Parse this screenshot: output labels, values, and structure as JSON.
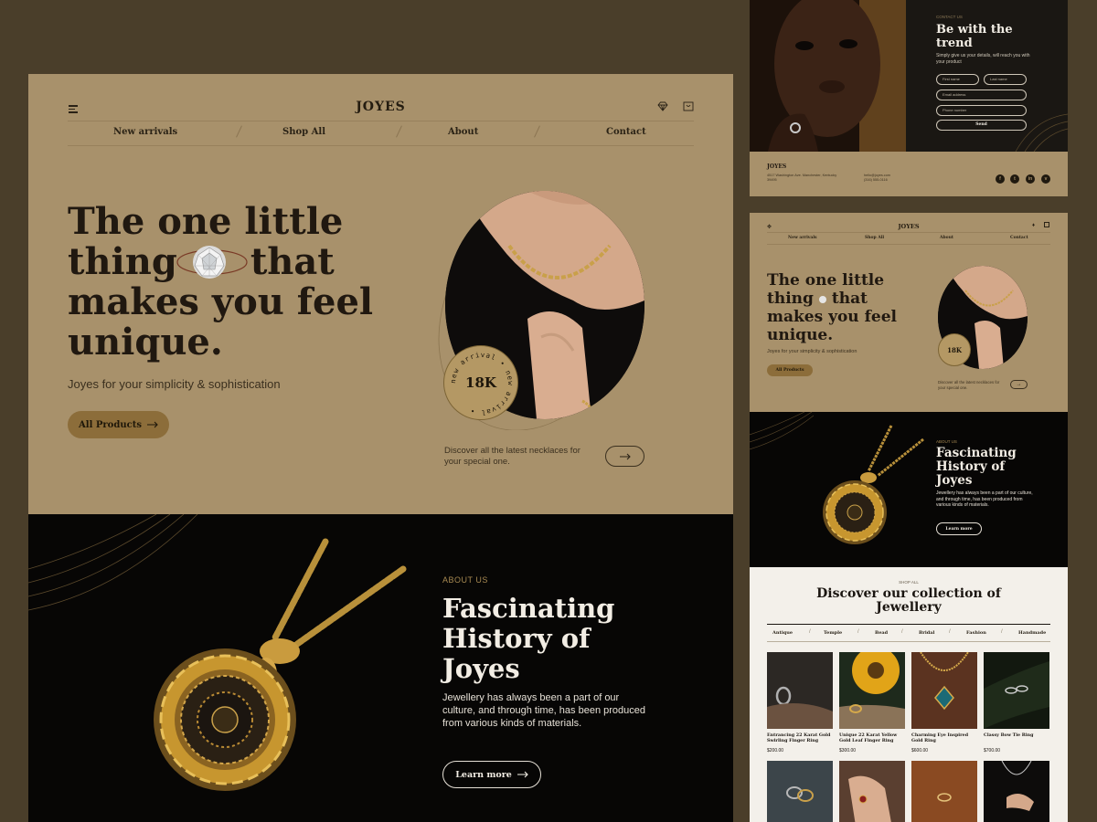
{
  "main": {
    "brand": "JOYES",
    "nav": [
      "New arrivals",
      "Shop All",
      "About",
      "Contact"
    ],
    "hero": {
      "title_line1": "The one little",
      "title_line2a": "thing",
      "title_line2b": "that",
      "title_line3": "makes you feel",
      "title_line4": "unique.",
      "subtitle": "Joyes for your simplicity & sophistication",
      "cta": "All Products",
      "badge_number": "18K",
      "badge_ring_text": "new arrival • new arrival •",
      "discover_text": "Discover all the latest necklaces for your special one."
    },
    "about": {
      "kicker": "ABOUT US",
      "title_line1": "Fascinating",
      "title_line2": "History of",
      "title_line3": "Joyes",
      "text": "Jewellery has always been a part of our culture, and through time, has been produced from various kinds of materials.",
      "cta": "Learn more"
    }
  },
  "contact_panel": {
    "kicker": "CONTACT US",
    "title_line1": "Be with the",
    "title_line2": "trend",
    "subtitle": "Simply give us your details, will reach you with your product",
    "first_name": "First name",
    "last_name": "Last name",
    "email": "Email address",
    "phone": "Phone number",
    "send": "Send",
    "footer_brand": "JOYES",
    "address": "4517 Washington Ave. Manchester, Kentucky 39495",
    "email_addr": "hello@joyes.com",
    "phone_num": "(316) 555-0116",
    "socials": [
      "f",
      "t",
      "in",
      "v"
    ]
  },
  "mobile": {
    "brand": "JOYES",
    "nav": [
      "New arrivals",
      "Shop All",
      "About",
      "Contact"
    ],
    "title_line1": "The one little",
    "title_line2a": "thing",
    "title_line2b": "that",
    "title_line3": "makes you feel",
    "title_line4": "unique.",
    "subtitle": "Joyes for your simplicity & sophistication",
    "cta": "All Products",
    "badge_number": "18K",
    "discover_text": "Discover all the latest necklaces for your special one.",
    "about_kicker": "ABOUT US",
    "about_title_line1": "Fascinating",
    "about_title_line2": "History of",
    "about_title_line3": "Joyes",
    "about_text": "Jewellery has always been a part of our culture, and through time, has been produced from various kinds of materials.",
    "about_cta": "Learn more",
    "shop_kicker": "SHOP ALL",
    "shop_title_line1": "Discover our collection of",
    "shop_title_line2": "Jewellery",
    "categories": [
      "Antique",
      "Temple",
      "Bead",
      "Bridal",
      "Fashion",
      "Handmade"
    ],
    "products": [
      {
        "name": "Entrancing 22 Karat Gold Swirling Finger Ring",
        "price": "$200.00"
      },
      {
        "name": "Unique 22 Karat Yellow Gold Leaf Finger Ring",
        "price": "$300.00"
      },
      {
        "name": "Charming Eye Inspired Gold Ring",
        "price": "$600.00"
      },
      {
        "name": "Classy Bow Tie Ring",
        "price": "$700.00"
      }
    ]
  },
  "colors": {
    "background": "#4a3e2a",
    "tan": "#a8916b",
    "gold": "#8c6d3a",
    "dark": "#070605",
    "cream": "#f3f0ea"
  }
}
